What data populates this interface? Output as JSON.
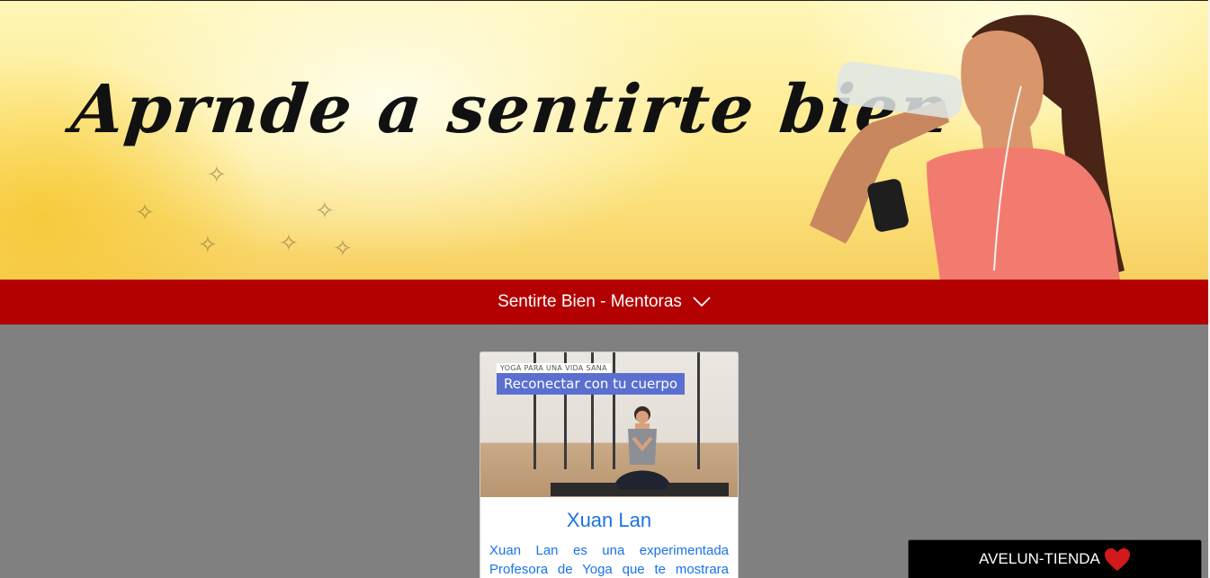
{
  "hero": {
    "title": "Aprnde a sentirte bien"
  },
  "nav": {
    "dropdown_label": "Sentirte Bien - Mentoras",
    "dropdown_icon": "chevron-down-icon"
  },
  "card": {
    "image_small_label": "YOGA PARA UNA VIDA SANA",
    "image_banner": "Reconectar con tu cuerpo",
    "title": "Xuan Lan",
    "text": "Xuan Lan es una experimentada Profesora de Yoga que te mostrara"
  },
  "shop": {
    "label": "AVELUN-TIENDA",
    "icon": "heart-icon"
  },
  "colors": {
    "nav_bg": "#b30000",
    "page_bg": "#808080",
    "card_text": "#1a73e8",
    "shop_bg": "#000000",
    "heart": "#d11a1a"
  }
}
